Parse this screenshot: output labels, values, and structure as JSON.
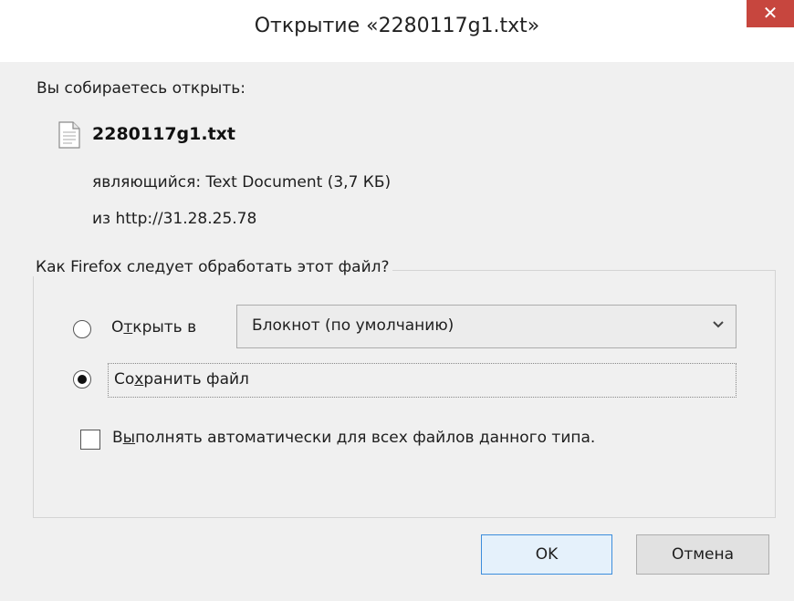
{
  "dialog": {
    "title": "Открытие «2280117g1.txt»",
    "close_symbol": "✕"
  },
  "file_info": {
    "intro": "Вы собираетесь открыть:",
    "icon": "text-file-icon",
    "filename": "2280117g1.txt",
    "type_line": "являющийся: Text Document (3,7 КБ)",
    "from_line": "из http://31.28.25.78"
  },
  "action_group": {
    "title": "Как Firefox следует обработать этот файл?",
    "open_with": {
      "label_pre": "О",
      "label_accel": "т",
      "label_post": "крыть в",
      "selected": false,
      "app_value": "Блокнот (по умолчанию)"
    },
    "save_file": {
      "label_pre": "Со",
      "label_accel": "х",
      "label_post": "ранить файл",
      "selected": true
    },
    "auto_checkbox": {
      "label_pre": "В",
      "label_accel": "ы",
      "label_post": "полнять автоматически для всех файлов данного типа.",
      "checked": false
    }
  },
  "buttons": {
    "ok_label": "OK",
    "cancel_label": "Отмена"
  },
  "colors": {
    "close_button": "#c7463e",
    "dialog_background": "#f0f0f0",
    "ok_focus_border": "#3c8ddc"
  }
}
